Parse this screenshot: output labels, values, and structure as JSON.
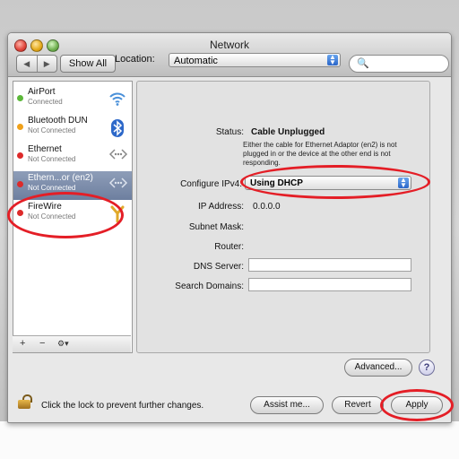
{
  "window": {
    "title": "Network"
  },
  "toolbar": {
    "back": "◀",
    "forward": "▶",
    "show_all": "Show All",
    "search_placeholder": ""
  },
  "location": {
    "label": "Location:",
    "value": "Automatic"
  },
  "services": [
    {
      "name": "AirPort",
      "status": "Connected",
      "dot_color": "#5cb83a",
      "icon": "wifi-icon",
      "glyph": "📶"
    },
    {
      "name": "Bluetooth DUN",
      "status": "Not Connected",
      "dot_color": "#f0a11a",
      "icon": "bluetooth-icon",
      "glyph": "✱"
    },
    {
      "name": "Ethernet",
      "status": "Not Connected",
      "dot_color": "#dd2a2a",
      "icon": "ethernet-icon",
      "glyph": "⇔"
    },
    {
      "name": "Ethern...or (en2)",
      "status": "Not Connected",
      "dot_color": "#dd2a2a",
      "icon": "ethernet-icon",
      "glyph": "⇔",
      "selected": true
    },
    {
      "name": "FireWire",
      "status": "Not Connected",
      "dot_color": "#dd2a2a",
      "icon": "firewire-icon",
      "glyph": "Y"
    }
  ],
  "sidebar_buttons": {
    "add": "+",
    "remove": "−",
    "action": "⚙▾"
  },
  "details": {
    "status_label": "Status:",
    "status_value": "Cable Unplugged",
    "status_note": "Either the cable for Ethernet Adaptor (en2) is not plugged in or the device at the other end is not responding.",
    "ipv4_label": "Configure IPv4:",
    "ipv4_value": "Using DHCP",
    "ip_label": "IP Address:",
    "ip_value": "0.0.0.0",
    "subnet_label": "Subnet Mask:",
    "router_label": "Router:",
    "dns_label": "DNS Server:",
    "search_domains_label": "Search Domains:",
    "advanced_label": "Advanced...",
    "help_label": "?"
  },
  "footer": {
    "lock_text": "Click the lock to prevent further changes.",
    "assist_label": "Assist me...",
    "revert_label": "Revert",
    "apply_label": "Apply"
  },
  "colors": {
    "annotation_red": "#e41e26",
    "selection": "#7c8dab"
  }
}
